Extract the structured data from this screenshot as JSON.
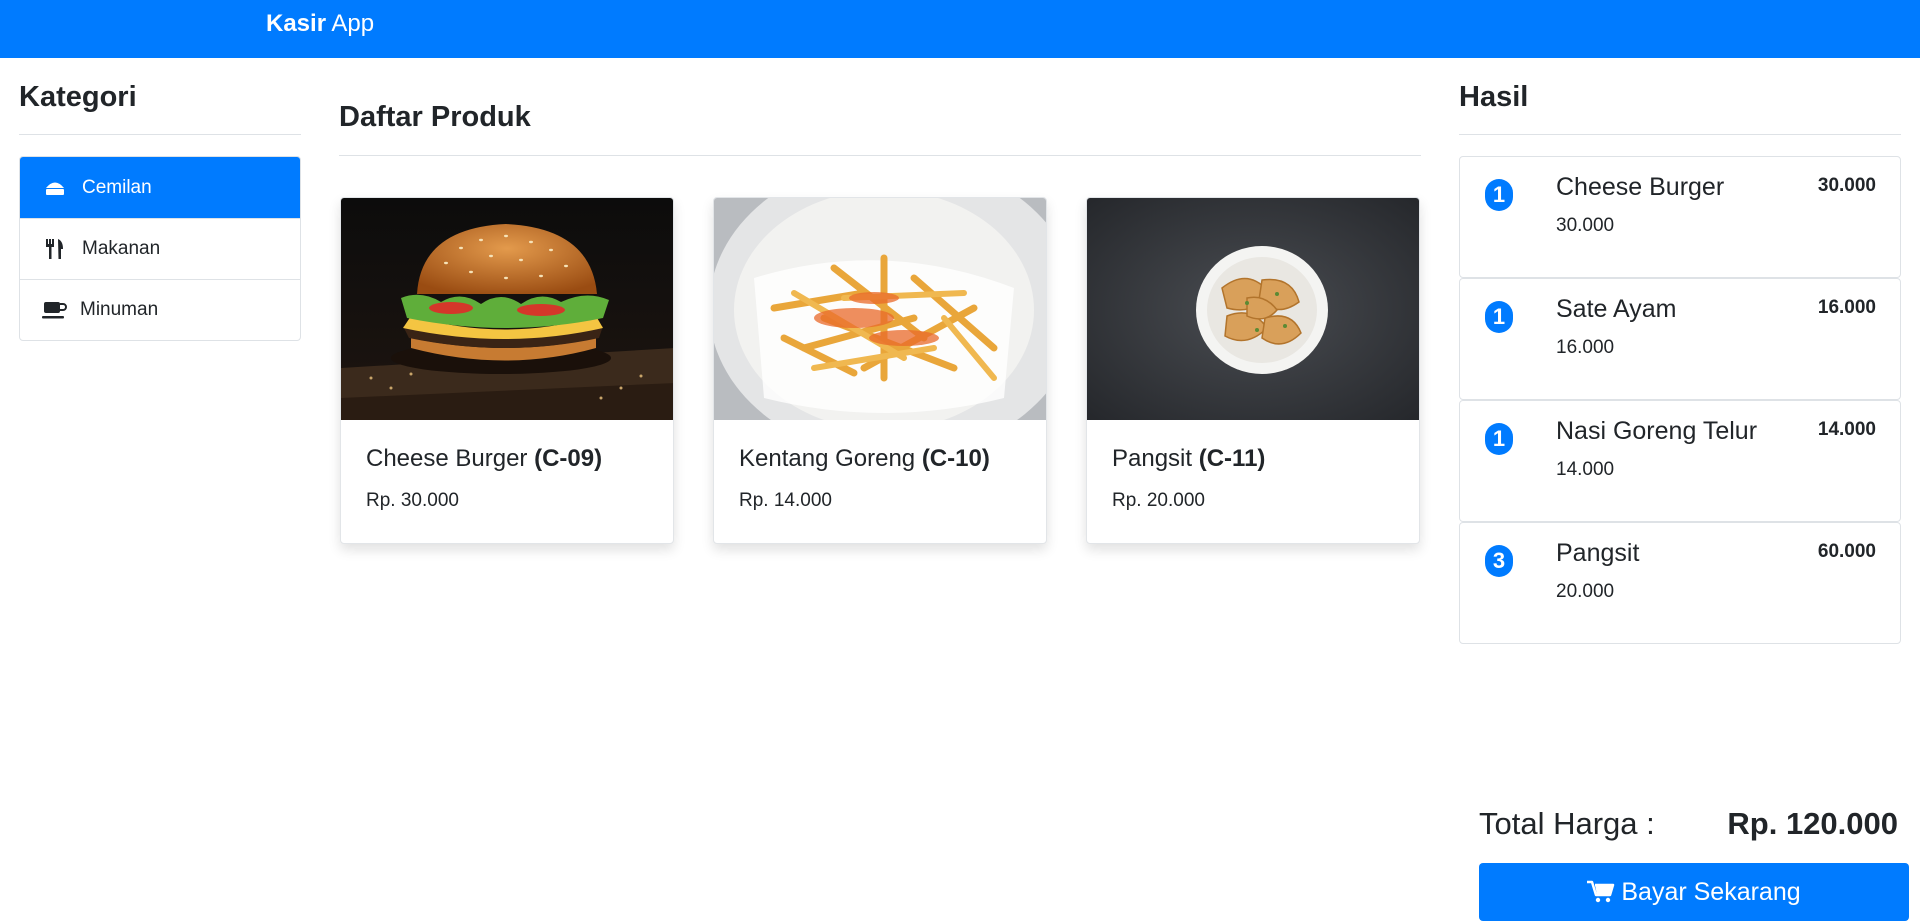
{
  "navbar": {
    "brand_bold": "Kasir",
    "brand_rest": " App"
  },
  "sidebar": {
    "title": "Kategori",
    "items": [
      {
        "label": "Cemilan",
        "icon": "cake-icon",
        "active": true
      },
      {
        "label": "Makanan",
        "icon": "utensils-icon",
        "active": false
      },
      {
        "label": "Minuman",
        "icon": "coffee-icon",
        "active": false
      }
    ]
  },
  "products": {
    "title": "Daftar Produk",
    "items": [
      {
        "name": "Cheese Burger",
        "code": "(C-09)",
        "price": "Rp. 30.000",
        "image": "cheese-burger-photo"
      },
      {
        "name": "Kentang Goreng",
        "code": "(C-10)",
        "price": "Rp. 14.000",
        "image": "french-fries-photo"
      },
      {
        "name": "Pangsit",
        "code": "(C-11)",
        "price": "Rp. 20.000",
        "image": "fried-wonton-photo"
      }
    ]
  },
  "cart": {
    "title": "Hasil",
    "items": [
      {
        "qty": "1",
        "name": "Cheese Burger",
        "unit_price": "30.000",
        "total": "30.000"
      },
      {
        "qty": "1",
        "name": "Sate Ayam",
        "unit_price": "16.000",
        "total": "16.000"
      },
      {
        "qty": "1",
        "name": "Nasi Goreng Telur",
        "unit_price": "14.000",
        "total": "14.000"
      },
      {
        "qty": "3",
        "name": "Pangsit",
        "unit_price": "20.000",
        "total": "60.000"
      }
    ],
    "total_label": "Total Harga :",
    "total_value": "Rp. 120.000",
    "pay_label": "Bayar Sekarang"
  },
  "colors": {
    "primary": "#007bff",
    "text": "#212529",
    "border": "#dee2e6"
  }
}
